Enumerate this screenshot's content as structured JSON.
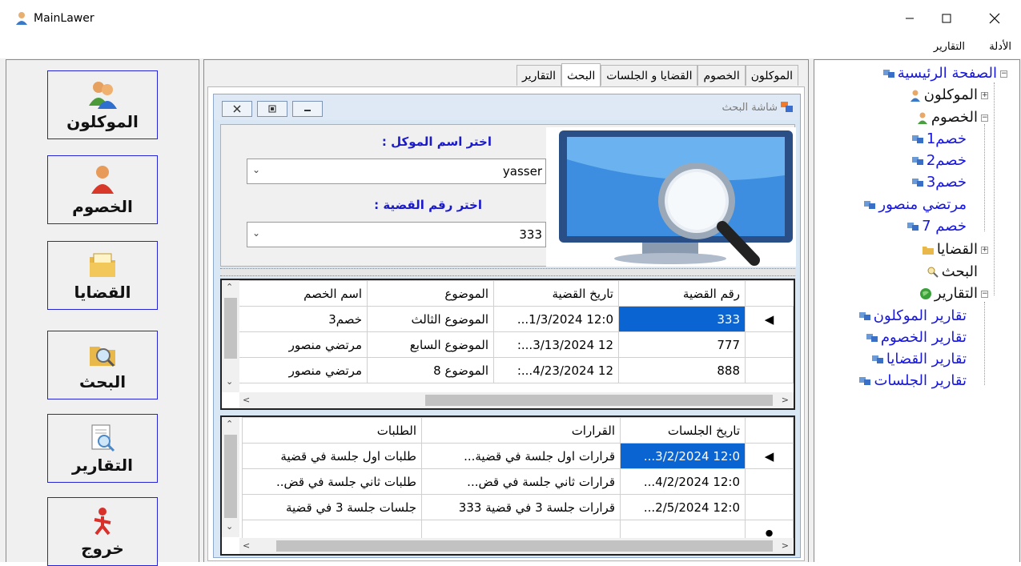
{
  "window": {
    "title": "MainLawer"
  },
  "menu": [
    {
      "label": "الأدلة"
    },
    {
      "label": "التقارير"
    }
  ],
  "side_buttons": [
    {
      "label": "الموكلون",
      "icon": "clients-icon"
    },
    {
      "label": "الخصوم",
      "icon": "opponents-icon"
    },
    {
      "label": "القضايا",
      "icon": "folder-icon"
    },
    {
      "label": "البحث",
      "icon": "search-folder-icon"
    },
    {
      "label": "التقارير",
      "icon": "report-search-icon"
    },
    {
      "label": "خروج",
      "icon": "exit-icon"
    }
  ],
  "tabs": [
    {
      "label": "الموكلون"
    },
    {
      "label": "الخصوم"
    },
    {
      "label": "القضايا و الجلسات"
    },
    {
      "label": "البحث",
      "active": true
    },
    {
      "label": "التقارير"
    }
  ],
  "search_window": {
    "title": "شاشة البحث",
    "client_label": "اختر اسم الموكل :",
    "client_value": "yasser",
    "case_label": "اختر رقم  القضية :",
    "case_value": "333"
  },
  "cases_grid": {
    "headers": [
      "رقم القضية",
      "تاريخ القضية",
      "الموضوع",
      "اسم الخصم"
    ],
    "rows": [
      [
        "333",
        "12:0 1/3/2024...",
        "الموضوع الثالث",
        "خصم3"
      ],
      [
        "777",
        "12 3/13/2024...:",
        "الموضوع السابع",
        "مرتضي منصور"
      ],
      [
        "888",
        "12 4/23/2024...:",
        "الموضوع 8",
        "مرتضي منصور"
      ]
    ]
  },
  "sessions_grid": {
    "headers": [
      "تاريخ الجلسات",
      "القرارات",
      "الطلبات"
    ],
    "rows": [
      [
        "12:0 3/2/2024...",
        "قرارات اول جلسة في قضية...",
        "طلبات اول جلسة في قضية"
      ],
      [
        "12:0 4/2/2024...",
        "قرارات ثاني جلسة في قض...",
        "طلبات ثاني جلسة في قض.."
      ],
      [
        "12:0 2/5/2024...",
        "قرارات جلسة 3 في قضية 333",
        "جلسات جلسة 3 في قضية"
      ]
    ]
  },
  "tree": {
    "root": "الصفحة الرئيسية",
    "clients": "الموكلون",
    "opponents": "الخصوم",
    "opponent_items": [
      "خصم1",
      "خصم2",
      "خصم3",
      "مرتضي منصور",
      "خصم 7"
    ],
    "cases": "القضايا",
    "search": "البحث",
    "reports": "التقارير",
    "report_items": [
      "تقارير الموكلون",
      "تقارير الخصوم",
      "تقارير القضايا",
      "تقارير الجلسات"
    ]
  },
  "colors": {
    "selection": "#0a64d2",
    "link": "#1616e0",
    "button_border": "#2424d6"
  }
}
